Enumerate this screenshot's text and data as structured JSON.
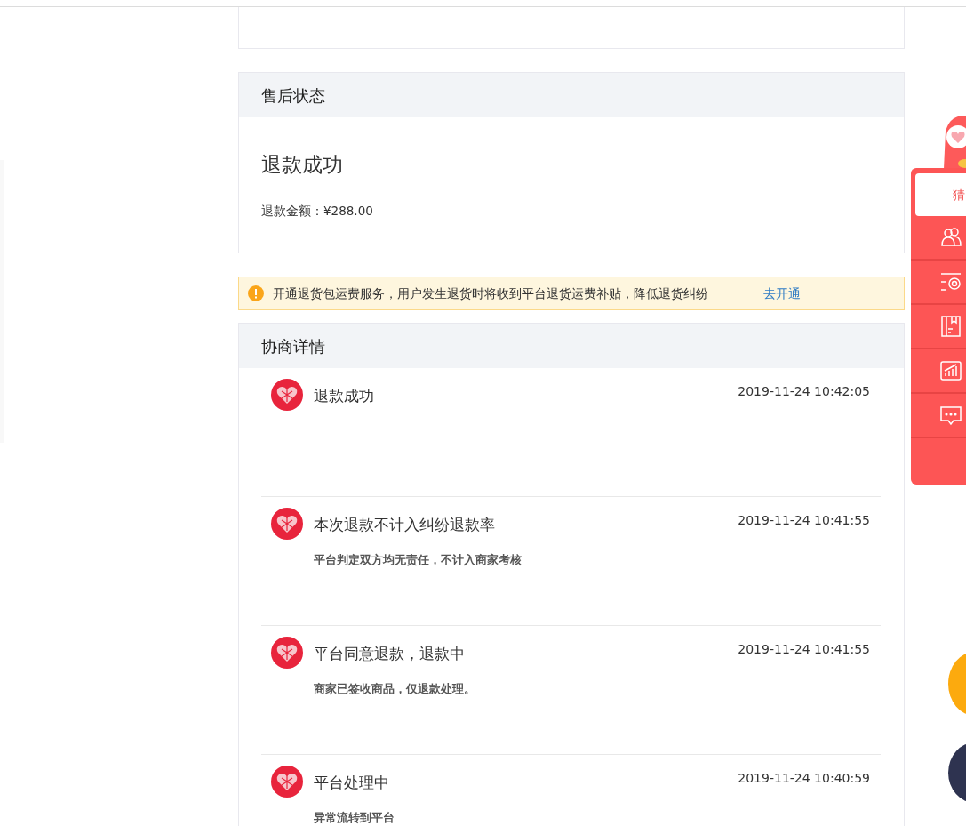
{
  "after_sale": {
    "title": "售后状态",
    "status": "退款成功",
    "amount_label": "退款金额：",
    "amount": "¥288.00"
  },
  "notice": {
    "text": "开通退货包运费服务，用户发生退货时将收到平台退货运费补贴，降低退货纠纷",
    "link": "去开通"
  },
  "negotiation": {
    "title": "协商详情",
    "events": [
      {
        "title": "退款成功",
        "time": "2019-11-24 10:42:05"
      },
      {
        "title": "本次退款不计入纠纷退款率",
        "detail": "平台判定双方均无责任，不计入商家考核",
        "time": "2019-11-24 10:41:55"
      },
      {
        "title": "平台同意退款，退款中",
        "detail": "商家已签收商品，仅退款处理。",
        "time": "2019-11-24 10:41:55"
      },
      {
        "title": "平台处理中",
        "detail": "异常流转到平台",
        "time": "2019-11-24 10:40:59"
      }
    ]
  },
  "side_toolbar": {
    "tab": "猜",
    "items": [
      {
        "kind": "people"
      },
      {
        "kind": "settings"
      },
      {
        "kind": "book"
      },
      {
        "kind": "chart"
      },
      {
        "kind": "chat"
      }
    ]
  }
}
